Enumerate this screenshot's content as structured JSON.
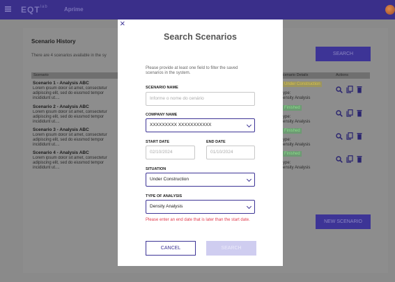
{
  "topbar": {
    "logo": "EQT",
    "logo_sup": "lab",
    "product": "Aprime"
  },
  "history": {
    "title": "Scenario History",
    "subtitle": "There are 4 scenarios available in the sy",
    "search_label": "SEARCH",
    "new_label": "NEW SCENARIO",
    "columns": [
      "Scenario",
      "cenario Details",
      "Actions"
    ],
    "rows": [
      {
        "title": "Scenario 1 - Analysis ABC",
        "desc": "Lorem ipsum dolor sit amet, consectetur adipiscing elit, sed do eiusmod tempor incididunt ut....",
        "status": "Under Construction",
        "type_label": "ype:",
        "type_value": "ensity Analysis"
      },
      {
        "title": "Scenario 2 - Analysis ABC",
        "desc": "Lorem ipsum dolor sit amet, consectetur adipiscing elit, sed do eiusmod tempor incididunt ut....",
        "status": "Finished",
        "type_label": "ype:",
        "type_value": "ensity Analysis"
      },
      {
        "title": "Scenario 3 - Analysis ABC",
        "desc": "Lorem ipsum dolor sit amet, consectetur adipiscing elit, sed do eiusmod tempor incididunt ut....",
        "status": "Finished",
        "type_label": "ype:",
        "type_value": "ensity Analysis"
      },
      {
        "title": "Scenario 4 - Analysis ABC",
        "desc": "Lorem ipsum dolor sit amet, consectetur adipiscing elit, sed do eiusmod tempor incididunt ut....",
        "status": "Finished",
        "type_label": "ype:",
        "type_value": "ensity Analysis"
      }
    ]
  },
  "modal": {
    "close": "×",
    "title": "Search Scenarios",
    "intro": "Please provide at least one field to filter the saved scenarios in the system.",
    "scenario_name": {
      "label": "SCENARIO NAME",
      "placeholder": "Informe o nome do cenário"
    },
    "company_name": {
      "label": "COMPANY NAME",
      "value": "XXXXXXXXX XXXXXXXXXXX"
    },
    "start_date": {
      "label": "START DATE",
      "value": "02/10/2024"
    },
    "end_date": {
      "label": "END DATE",
      "value": "01/10/2024"
    },
    "situation": {
      "label": "SITUATION",
      "value": "Under Construction"
    },
    "analysis_type": {
      "label": "TYPE OF ANALYSIS",
      "value": "Density Analysis"
    },
    "error": "Please enter an end date that is later than the start date.",
    "cancel_label": "CANCEL",
    "search_label": "SEARCH"
  },
  "colors": {
    "primary": "#3d3496",
    "error": "#e0394b",
    "disabled": "#cfcdf0"
  }
}
